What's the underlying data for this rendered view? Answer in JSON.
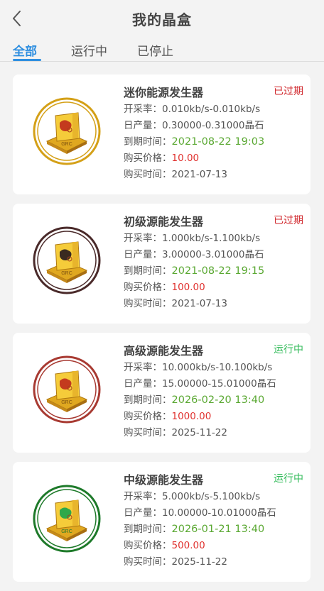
{
  "header": {
    "title": "我的晶盒",
    "back_icon": "chevron-left-icon"
  },
  "tabs": [
    {
      "label": "全部",
      "active": true
    },
    {
      "label": "运行中",
      "active": false
    },
    {
      "label": "已停止",
      "active": false
    }
  ],
  "colors": {
    "accent": "#2f8fe0",
    "expired": "#d0262b",
    "running": "#2fba57",
    "date": "#5aa832",
    "price": "#e0322f"
  },
  "labels": {
    "rate": "开采率：",
    "daily": "日产量：",
    "expire": "到期时间：",
    "price": "购买价格：",
    "bought": "购买时间："
  },
  "cards": [
    {
      "name": "迷你能源发生器",
      "status": "已过期",
      "status_color": "#d0262b",
      "rate": "0.010kb/s-0.010kb/s",
      "daily": "0.30000-0.31000晶石",
      "expire": "2021-08-22 19:03",
      "price": "10.00",
      "bought": "2021-07-13",
      "ring_color": "#d4a017",
      "emblem_text": "GRC"
    },
    {
      "name": "初级源能发生器",
      "status": "已过期",
      "status_color": "#d0262b",
      "rate": "1.000kb/s-1.100kb/s",
      "daily": "3.00000-3.01000晶石",
      "expire": "2021-08-22 19:15",
      "price": "100.00",
      "bought": "2021-07-13",
      "ring_color": "#4a2a2a",
      "emblem_text": "GRC"
    },
    {
      "name": "高级源能发生器",
      "status": "运行中",
      "status_color": "#2fba57",
      "rate": "10.000kb/s-10.100kb/s",
      "daily": "15.00000-15.01000晶石",
      "expire": "2026-02-20 13:40",
      "price": "1000.00",
      "bought": "2025-11-22",
      "ring_color": "#a83a32",
      "emblem_text": "GRC"
    },
    {
      "name": "中级源能发生器",
      "status": "运行中",
      "status_color": "#2fba57",
      "rate": "5.000kb/s-5.100kb/s",
      "daily": "10.00000-10.01000晶石",
      "expire": "2026-01-21 13:40",
      "price": "500.00",
      "bought": "2025-11-22",
      "ring_color": "#1e7a2a",
      "emblem_text": "GRC"
    }
  ]
}
